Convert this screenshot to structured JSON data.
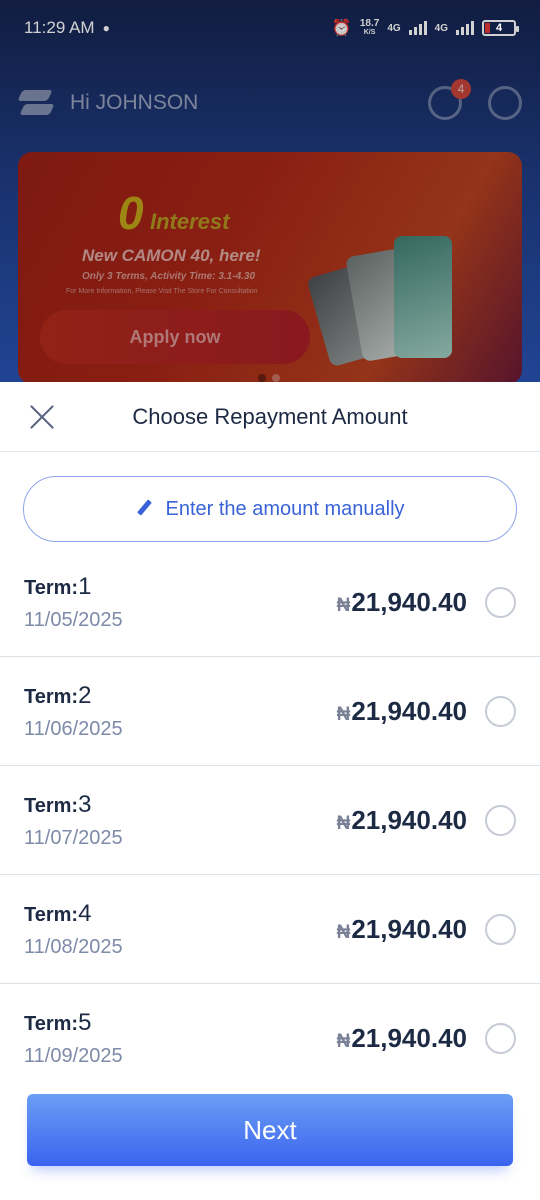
{
  "status_bar": {
    "time": "11:29 AM",
    "network_speed_value": "18.7",
    "network_speed_unit": "K/S",
    "network_1": "4G",
    "network_2": "4G",
    "battery": "4"
  },
  "background_app": {
    "greeting": "Hi JOHNSON",
    "notification_count": "4",
    "banner": {
      "zero": "0",
      "interest": "Interest",
      "headline": "New CAMON 40, here!",
      "subline": "Only 3 Terms, Activity Time: 3.1-4.30",
      "small_print": "For More Information, Please Visit The Store For Consultation",
      "apply_label": "Apply now"
    }
  },
  "sheet": {
    "title": "Choose Repayment Amount",
    "manual_button_label": "Enter the amount manually",
    "term_prefix": "Term:",
    "currency_symbol": "₦",
    "terms": [
      {
        "number": "1",
        "date": "11/05/2025",
        "amount": "21,940.40",
        "selected": false
      },
      {
        "number": "2",
        "date": "11/06/2025",
        "amount": "21,940.40",
        "selected": false
      },
      {
        "number": "3",
        "date": "11/07/2025",
        "amount": "21,940.40",
        "selected": false
      },
      {
        "number": "4",
        "date": "11/08/2025",
        "amount": "21,940.40",
        "selected": false
      },
      {
        "number": "5",
        "date": "11/09/2025",
        "amount": "21,940.40",
        "selected": false
      }
    ],
    "next_label": "Next"
  },
  "colors": {
    "accent": "#3b63ef",
    "text_primary": "#1d2a44",
    "text_secondary": "#7d8aa8"
  }
}
